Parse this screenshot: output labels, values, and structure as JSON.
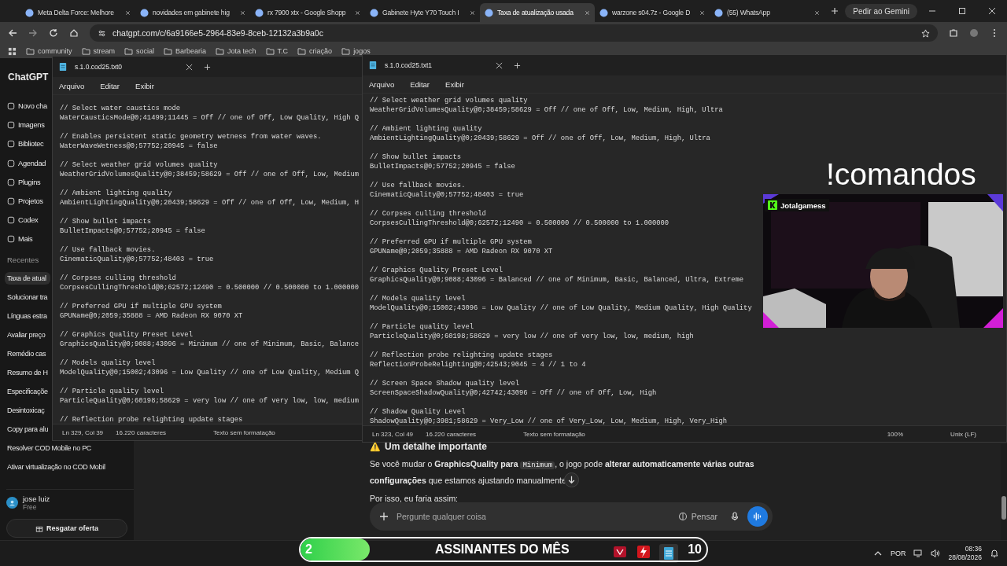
{
  "browser": {
    "tabs": [
      {
        "title": "Meta Delta Force: Melhore",
        "selected": false
      },
      {
        "title": "novidades em gabinete hig",
        "selected": false
      },
      {
        "title": "rx 7900 xtx - Google Shopp",
        "selected": false
      },
      {
        "title": "Gabinete Hyte Y70 Touch I",
        "selected": false
      },
      {
        "title": "Taxa de atualização usada",
        "selected": true
      },
      {
        "title": "warzone s04.7z - Google D",
        "selected": false
      },
      {
        "title": "(55) WhatsApp",
        "selected": false
      }
    ],
    "gemini_button": "Pedir ao Gemini",
    "url": "chatgpt.com/c/6a9166e5-2964-83e9-8ceb-12132a3b9a0c",
    "bookmarks": [
      "community",
      "stream",
      "social",
      "Barbearia",
      "Jota tech",
      "T.C",
      "criação",
      "jogos"
    ]
  },
  "chatgpt": {
    "logo": "ChatGPT",
    "nav": [
      "Novo cha",
      "Imagens",
      "Bibliotec",
      "Agendad",
      "Plugins",
      "Projetos",
      "Codex",
      "Mais"
    ],
    "recents_label": "Recentes",
    "recents": [
      {
        "title": "Taxa de atual",
        "selected": true
      },
      {
        "title": "Solucionar tra",
        "selected": false
      },
      {
        "title": "Línguas estra",
        "selected": false
      },
      {
        "title": "Avaliar preço",
        "selected": false
      },
      {
        "title": "Remédio cas",
        "selected": false
      },
      {
        "title": "Resumo de H",
        "selected": false
      },
      {
        "title": "Especificaçõe",
        "selected": false
      },
      {
        "title": "Desintoxicaç",
        "selected": false
      },
      {
        "title": "Copy para alu",
        "selected": false
      },
      {
        "title": "Resolver COD Mobile no PC",
        "selected": false
      },
      {
        "title": "Ativar virtualização no COD Mobil",
        "selected": false
      }
    ],
    "user": {
      "name": "jose luiz",
      "plan": "Free"
    },
    "offer_button": "Resgatar oferta",
    "message": {
      "icon": "⚠️",
      "heading": "Um detalhe importante",
      "paragraph_start": "Se você mudar o **GraphicsQuality para**",
      "code": "Minimum",
      "paragraph_end": ", o jogo pode **alterar automaticamente várias outras configurações** que estamos ajustando manualmente",
      "next_line": "Por isso, eu faria assim:"
    },
    "composer": {
      "placeholder": "Pergunte qualquer coisa",
      "think_button": "Pensar"
    }
  },
  "notepads": [
    {
      "tab_title": "s.1.0.cod25.txt0",
      "menu": [
        "Arquivo",
        "Editar",
        "Exibir"
      ],
      "entries": [
        {
          "comment": "// Select water caustics mode",
          "code": "WaterCausticsMode@0;41499;11445 = Off // one of Off, Low Quality, High Q"
        },
        {
          "comment": "// Enables persistent static geometry wetness from water waves.",
          "code": "WaterWaveWetness@0;57752;20945 = false"
        },
        {
          "comment": "// Select weather grid volumes quality",
          "code": "WeatherGridVolumesQuality@0;38459;58629 = Off // one of Off, Low, Medium"
        },
        {
          "comment": "// Ambient lighting quality",
          "code": "AmbientLightingQuality@0;20439;58629 = Off // one of Off, Low, Medium, H"
        },
        {
          "comment": "// Show bullet impacts",
          "code": "BulletImpacts@0;57752;20945 = false"
        },
        {
          "comment": "// Use fallback movies.",
          "code": "CinematicQuality@0;57752;48403 = true"
        },
        {
          "comment": "// Corpses culling threshold",
          "code": "CorpsesCullingThreshold@0;62572;12490 = 0.500000 // 0.500000 to 1.000000"
        },
        {
          "comment": "// Preferred GPU if multiple GPU system",
          "code": "GPUName@0;2059;35888 = AMD Radeon RX 9070 XT"
        },
        {
          "comment": "// Graphics Quality Preset Level",
          "code": "GraphicsQuality@0;9088;43096 = Minimum // one of Minimum, Basic, Balance"
        },
        {
          "comment": "// Models quality level",
          "code": "ModelQuality@0;15002;43096 = Low Quality // one of Low Quality, Medium Q"
        },
        {
          "comment": "// Particle quality level",
          "code": "ParticleQuality@0;60198;58629 = very low // one of very low, low, medium"
        },
        {
          "comment": "// Reflection probe relighting update stages"
        }
      ],
      "status": [
        "Ln 329, Col 39",
        "16.220 caracteres",
        "Texto sem formatação"
      ]
    },
    {
      "tab_title": "s.1.0.cod25.txt1",
      "menu": [
        "Arquivo",
        "Editar",
        "Exibir"
      ],
      "entries": [
        {
          "comment": "// Select weather grid volumes quality",
          "code": "WeatherGridVolumesQuality@0;38459;58629 = Off // one of Off, Low, Medium, High, Ultra"
        },
        {
          "comment": "// Ambient lighting quality",
          "code": "AmbientLightingQuality@0;20439;58629 = Off // one of Off, Low, Medium, High, Ultra"
        },
        {
          "comment": "// Show bullet impacts",
          "code": "BulletImpacts@0;57752;20945 = false"
        },
        {
          "comment": "// Use fallback movies.",
          "code": "CinematicQuality@0;57752;48403 = true"
        },
        {
          "comment": "// Corpses culling threshold",
          "code": "CorpsesCullingThreshold@0;62572;12490 = 0.500000 // 0.500000 to 1.000000"
        },
        {
          "comment": "// Preferred GPU if multiple GPU system",
          "code": "GPUName@0;2059;35888 = AMD Radeon RX 9070 XT"
        },
        {
          "comment": "// Graphics Quality Preset Level",
          "code": "GraphicsQuality@0;9088;43096 = Balanced // one of Minimum, Basic, Balanced, Ultra, Extreme"
        },
        {
          "comment": "// Models quality level",
          "code": "ModelQuality@0;15002;43096 = Low Quality // one of Low Quality, Medium Quality, High Quality"
        },
        {
          "comment": "// Particle quality level",
          "code": "ParticleQuality@0;60198;58629 = very low // one of very low, low, medium, high"
        },
        {
          "comment": "// Reflection probe relighting update stages",
          "code": "ReflectionProbeRelighting@0;42543;9045 = 4 // 1 to 4"
        },
        {
          "comment": "// Screen Space Shadow quality level",
          "code": "ScreenSpaceShadowQuality@0;42742;43096 = Off // one of Off, Low, High"
        },
        {
          "comment": "// Shadow Quality Level",
          "code": "ShadowQuality@0;3981;58629 = Very_Low // one of Very_Low, Low, Medium, High, Very_High"
        }
      ],
      "status": [
        "Ln 323, Col 49",
        "16.220 caracteres",
        "Texto sem formatação",
        "100%",
        "Unix (LF)"
      ]
    }
  ],
  "overlay": {
    "command": "!comandos",
    "channel": "Jotalgamess",
    "subs_label": "ASSINANTES DO MÊS",
    "current": "2",
    "goal": "10",
    "level": 0.17
  },
  "taskbar": {
    "language": "POR",
    "time": "08:36",
    "date": "28/08/2026"
  }
}
